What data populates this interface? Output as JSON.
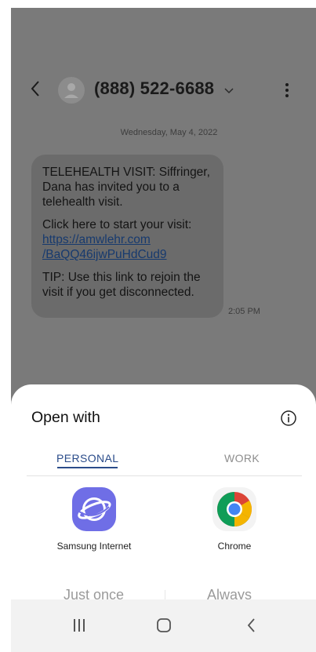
{
  "conversation": {
    "contact": "(888) 522-6688",
    "date": "Wednesday, May 4, 2022",
    "message": {
      "paragraph1": "TELEHEALTH VISIT: Siffringer, Dana has invited you to a telehealth visit.",
      "paragraph2_prefix": "Click here to start your visit:",
      "link_line1": "https://amwlehr.com",
      "link_line2": "/BaQQ46ijwPuHdCud9",
      "paragraph3": "TIP: Use this link to rejoin the visit if you get disconnected.",
      "time": "2:05 PM"
    },
    "icons": {
      "back": "back-arrow-icon",
      "avatar": "person-icon",
      "dropdown": "chevron-down-icon",
      "more": "more-vertical-icon"
    }
  },
  "sheet": {
    "title": "Open with",
    "info_icon": "info-icon",
    "tabs": [
      {
        "label": "PERSONAL",
        "active": true
      },
      {
        "label": "WORK",
        "active": false
      }
    ],
    "apps": [
      {
        "label": "Samsung Internet",
        "icon": "samsung-internet-icon"
      },
      {
        "label": "Chrome",
        "icon": "chrome-icon"
      }
    ],
    "actions": {
      "once": "Just once",
      "always": "Always"
    }
  },
  "navbar": {
    "recents_icon": "recent-apps-icon",
    "home_icon": "home-icon",
    "back_icon": "back-icon"
  },
  "colors": {
    "accent": "#2b4c8a",
    "link": "#173a6e",
    "overlay": "#7a7a7a",
    "sheet_bg": "#ffffff",
    "navbar_bg": "#f2f2f2"
  }
}
